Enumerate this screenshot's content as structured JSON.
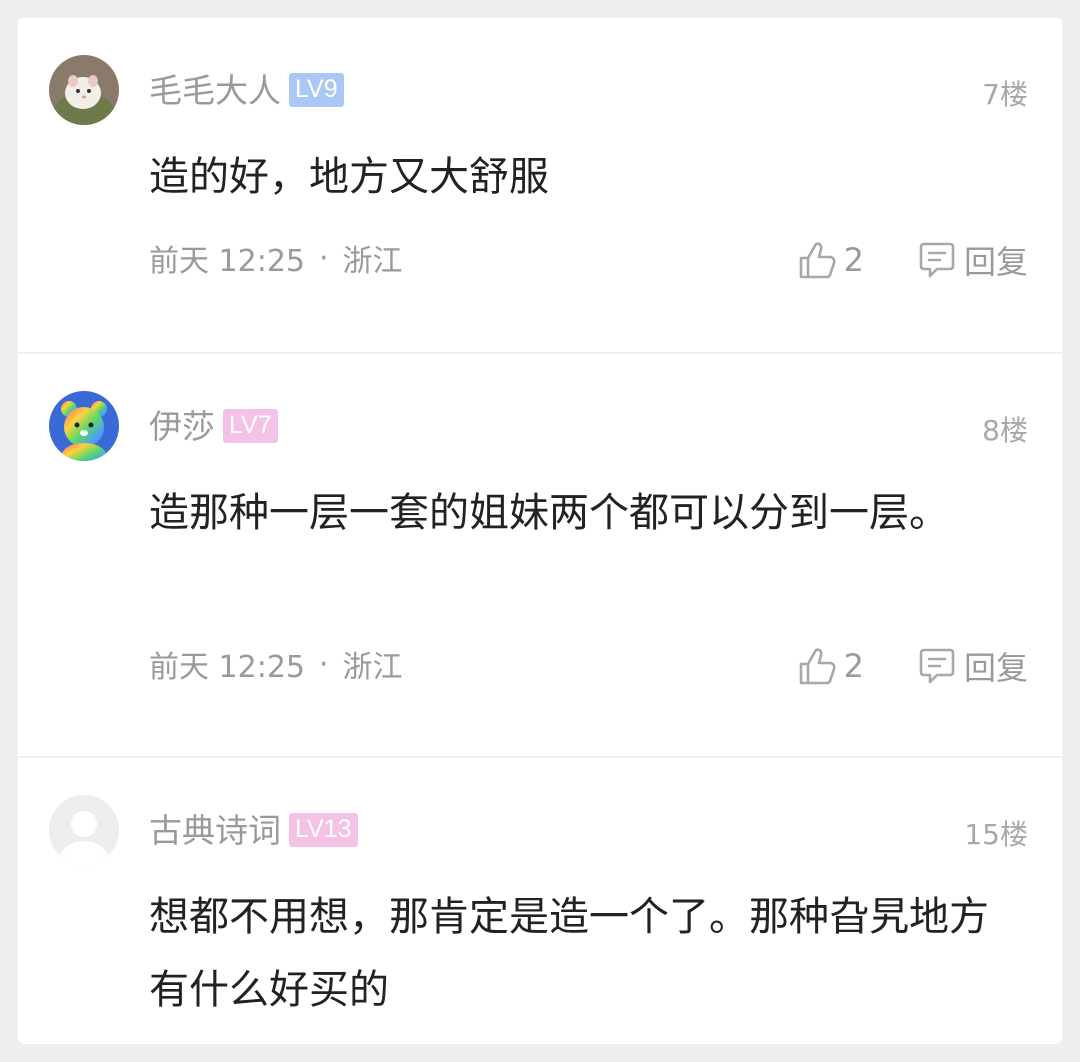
{
  "comments": [
    {
      "username": "毛毛大人",
      "level": "LV9",
      "level_color": "#a9c8f3",
      "floor": "7楼",
      "content": "造的好，地方又大舒服",
      "time": "前天 12:25",
      "location": "浙江",
      "likes": "2",
      "reply_label": "回复",
      "avatar_icon": "hamster-avatar-icon"
    },
    {
      "username": "伊莎",
      "level": "LV7",
      "level_color": "#f4c2e6",
      "floor": "8楼",
      "content": "造那种一层一套的姐妹两个都可以分到一层。",
      "time": "前天 12:25",
      "location": "浙江",
      "likes": "2",
      "reply_label": "回复",
      "avatar_icon": "rainbow-bear-avatar-icon"
    },
    {
      "username": "古典诗词",
      "level": "LV13",
      "level_color": "#f4c2e6",
      "floor": "15楼",
      "content": "想都不用想，那肯定是造一个了。那种旮旯地方有什么好买的",
      "avatar_icon": "default-avatar-icon"
    }
  ],
  "colors": {
    "background": "#efefef",
    "card": "#ffffff",
    "text_primary": "#222222",
    "text_secondary": "#9a9a9a"
  }
}
